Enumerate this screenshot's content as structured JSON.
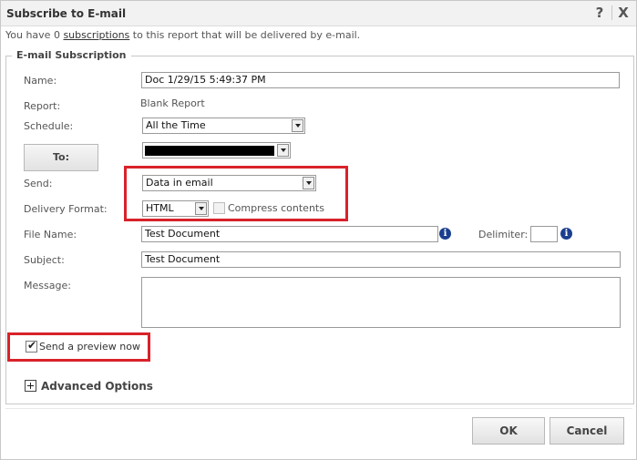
{
  "window": {
    "title": "Subscribe to E-mail",
    "help_label": "?",
    "close_label": "X"
  },
  "info": {
    "prefix": "You have 0 ",
    "link": "subscriptions",
    "suffix": " to this report that will be delivered by e-mail."
  },
  "section": {
    "legend": "E-mail Subscription"
  },
  "form": {
    "name_label": "Name:",
    "name_value": "Doc 1/29/15 5:49:37 PM",
    "report_label": "Report:",
    "report_value": "Blank Report",
    "schedule_label": "Schedule:",
    "schedule_value": "All the Time",
    "to_button": "To:",
    "send_label": "Send:",
    "send_value": "Data in email",
    "delivery_label": "Delivery Format:",
    "delivery_value": "HTML",
    "compress_label": "Compress contents",
    "compress_checked": false,
    "filename_label": "File Name:",
    "filename_value": "Test Document",
    "delimiter_label": "Delimiter:",
    "delimiter_value": "",
    "subject_label": "Subject:",
    "subject_value": "Test Document",
    "message_label": "Message:",
    "message_value": "",
    "preview_label": "Send a preview now",
    "preview_checked": true,
    "advanced_label": "Advanced Options",
    "info_glyph": "i"
  },
  "buttons": {
    "ok": "OK",
    "cancel": "Cancel"
  },
  "colors": {
    "highlight": "#d9222a",
    "info_icon": "#1b3f8f"
  }
}
